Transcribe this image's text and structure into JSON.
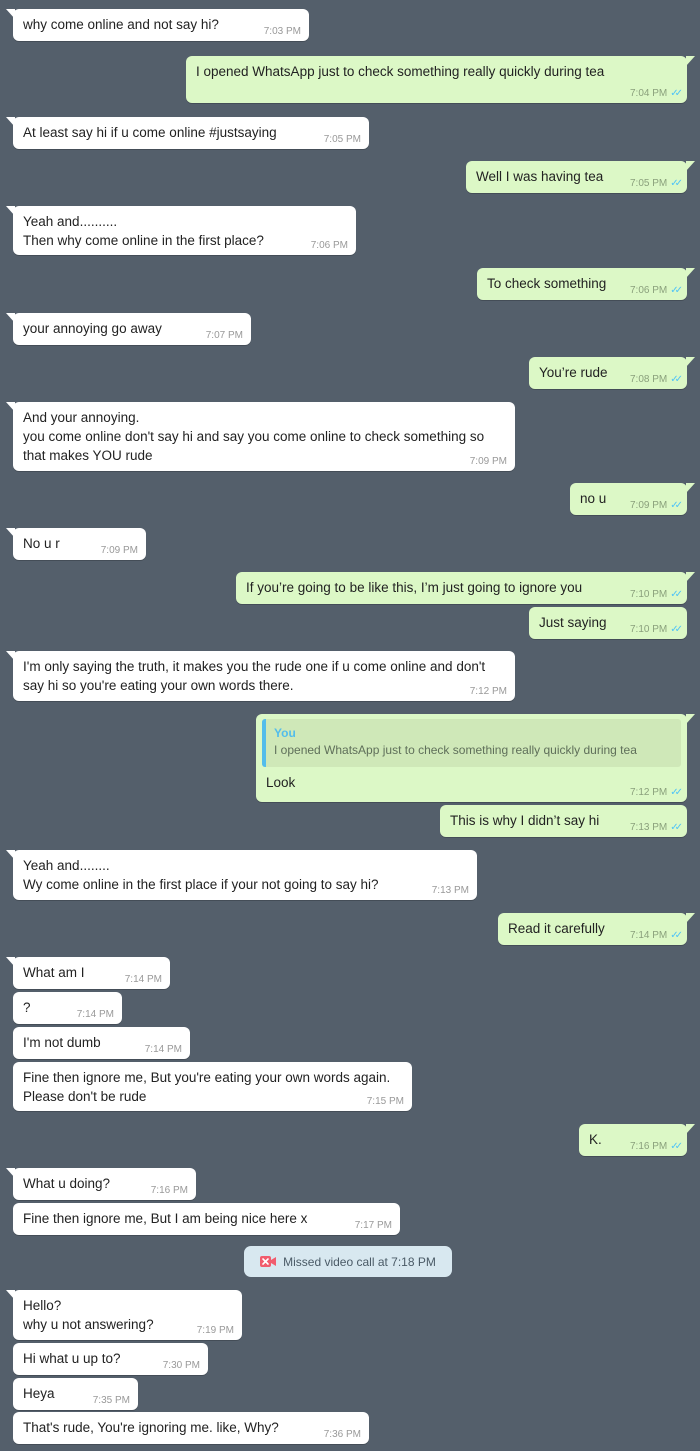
{
  "colors": {
    "background": "#545f6b",
    "incoming_bubble": "#ffffff",
    "outgoing_bubble": "#dcf8c6",
    "read_ticks": "#4fc3f7",
    "missed_call_icon": "#f15c6d"
  },
  "messages": [
    {
      "dir": "in",
      "text": "why come online and not say hi?",
      "time": "7:03 PM"
    },
    {
      "dir": "out",
      "text": "I opened WhatsApp just to check something really quickly during tea",
      "time": "7:04 PM",
      "ticks": "✓✓"
    },
    {
      "dir": "in",
      "text": "At least say hi if u come online #justsaying",
      "time": "7:05 PM"
    },
    {
      "dir": "out",
      "text": "Well I was having tea",
      "time": "7:05 PM",
      "ticks": "✓✓"
    },
    {
      "dir": "in",
      "text": "Yeah and..........\nThen why come online in the first place?",
      "time": "7:06 PM"
    },
    {
      "dir": "out",
      "text": "To check something",
      "time": "7:06 PM",
      "ticks": "✓✓"
    },
    {
      "dir": "in",
      "text": "your annoying go away",
      "time": "7:07 PM"
    },
    {
      "dir": "out",
      "text": "You’re rude",
      "time": "7:08 PM",
      "ticks": "✓✓"
    },
    {
      "dir": "in",
      "text": "And your annoying.\nyou come online don't say hi and say you come online to check something so that makes YOU rude",
      "time": "7:09 PM"
    },
    {
      "dir": "out",
      "text": "no u",
      "time": "7:09 PM",
      "ticks": "✓✓"
    },
    {
      "dir": "in",
      "text": "No u r",
      "time": "7:09 PM"
    },
    {
      "dir": "out",
      "text": "If you’re going to be like this, I’m just going to ignore you",
      "time": "7:10 PM",
      "ticks": "✓✓"
    },
    {
      "dir": "out",
      "text": "Just saying",
      "time": "7:10 PM",
      "ticks": "✓✓"
    },
    {
      "dir": "in",
      "text": "I'm only saying the truth, it makes you the rude one if u come online and don't say hi so you're eating your own words there.",
      "time": "7:12 PM"
    },
    {
      "dir": "out",
      "quote_author": "You",
      "quote_text": "I opened WhatsApp just to check something really quickly during tea",
      "text": "Look",
      "time": "7:12 PM",
      "ticks": "✓✓"
    },
    {
      "dir": "out",
      "text": "This is why I didn’t say hi",
      "time": "7:13 PM",
      "ticks": "✓✓"
    },
    {
      "dir": "in",
      "text": "Yeah and........\nWy come online in the first place if your not going to say hi?",
      "time": "7:13 PM"
    },
    {
      "dir": "out",
      "text": "Read it carefully",
      "time": "7:14 PM",
      "ticks": "✓✓"
    },
    {
      "dir": "in",
      "text": "What am I",
      "time": "7:14 PM"
    },
    {
      "dir": "in",
      "text": "?",
      "time": "7:14 PM"
    },
    {
      "dir": "in",
      "text": "I'm not dumb",
      "time": "7:14 PM"
    },
    {
      "dir": "in",
      "text": "Fine then ignore me, But you're eating your own words again.\nPlease don't be rude",
      "time": "7:15 PM"
    },
    {
      "dir": "out",
      "text": "K.",
      "time": "7:16 PM",
      "ticks": "✓✓"
    },
    {
      "dir": "in",
      "text": "What u doing?",
      "time": "7:16 PM"
    },
    {
      "dir": "in",
      "text": "Fine then ignore me, But I am being nice here x",
      "time": "7:17 PM"
    },
    {
      "dir": "in",
      "text": "Hello?\nwhy u not answering?",
      "time": "7:19 PM"
    },
    {
      "dir": "in",
      "text": "Hi what u up to?",
      "time": "7:30 PM"
    },
    {
      "dir": "in",
      "text": "Heya",
      "time": "7:35 PM"
    },
    {
      "dir": "in",
      "text": "That's rude, You're ignoring me. like, Why?",
      "time": "7:36 PM"
    }
  ],
  "system": {
    "missed_call_text": "Missed video call at 7:18 PM",
    "icon": "missed-video-call-icon"
  }
}
